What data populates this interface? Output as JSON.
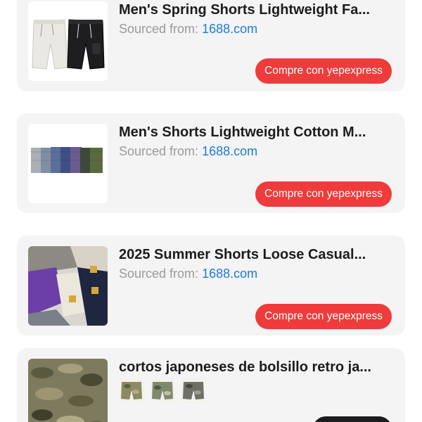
{
  "products": [
    {
      "title": "Men's Spring Shorts Lightweight Fa...",
      "source_label": "Sourced from:",
      "source_site": "1688.com",
      "button_label": "Compre con yepexpress",
      "image": "two-shorts-white-and-black-photo"
    },
    {
      "title": "Men's Shorts Lightweight Cotton M...",
      "source_label": "Sourced from:",
      "source_site": "1688.com",
      "button_label": "Compre con yepexpress",
      "image": "multi-color-shorts-row-photo"
    },
    {
      "title": "2025 Summer Shorts Loose Casual...",
      "source_label": "Sourced from:",
      "source_site": "1688.com",
      "button_label": "Compre con yepexpress",
      "image": "stacked-colored-shorts-photo"
    },
    {
      "title": "cortos japoneses de bolsillo retro ja...",
      "image": "camo-shorts-photo",
      "variants": [
        "camo-variant-1",
        "camo-variant-2",
        "camo-variant-3"
      ]
    }
  ],
  "colors": {
    "card_bg": "#f4f4f5",
    "title": "#1c1c1e",
    "source_label": "#9a9a9e",
    "source_link": "#1f7ad8",
    "buy_button": "#ef3b3b"
  }
}
